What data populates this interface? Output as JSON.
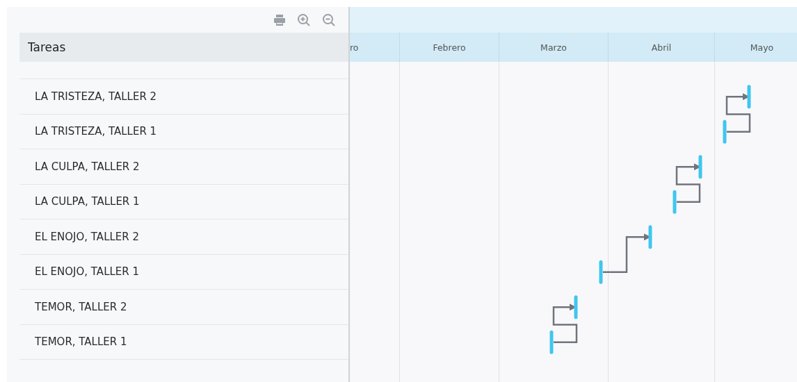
{
  "task_panel": {
    "header": "Tareas"
  },
  "timeline": {
    "months": [
      "ro",
      "Febrero",
      "Marzo",
      "Abril",
      "Mayo"
    ]
  },
  "tasks": [
    {
      "name": "LA TRISTEZA, TALLER 2"
    },
    {
      "name": "LA TRISTEZA, TALLER 1"
    },
    {
      "name": "LA CULPA, TALLER 2"
    },
    {
      "name": "LA CULPA, TALLER 1"
    },
    {
      "name": "EL ENOJO, TALLER 2"
    },
    {
      "name": "EL ENOJO, TALLER 1"
    },
    {
      "name": "TEMOR, TALLER 2"
    },
    {
      "name": "TEMOR, TALLER 1"
    }
  ]
}
